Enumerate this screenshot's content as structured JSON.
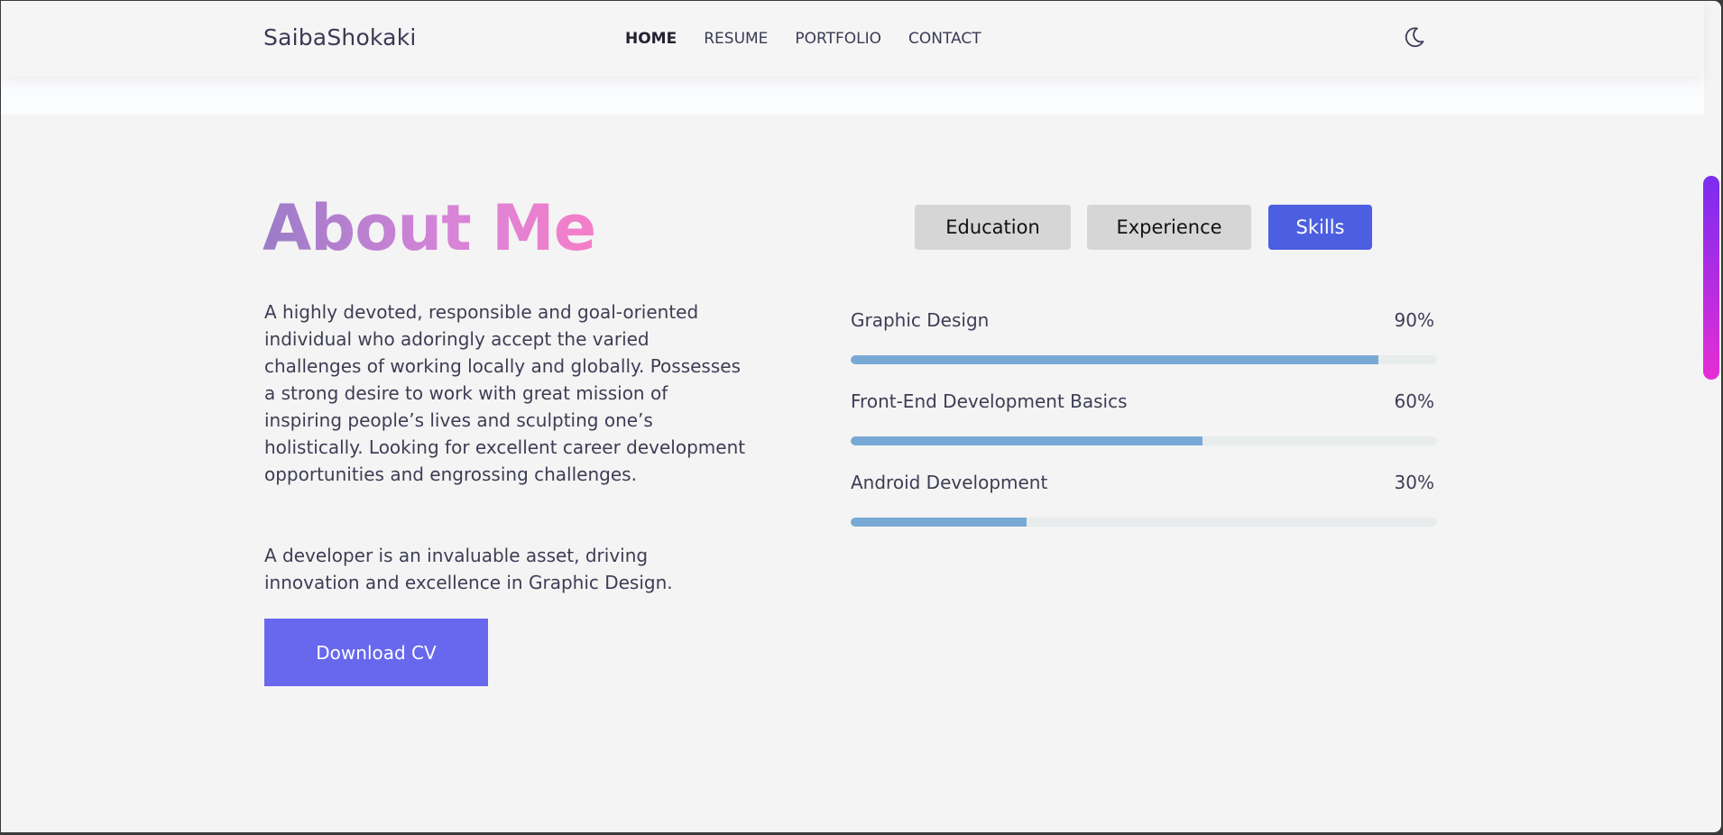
{
  "header": {
    "brand": "SaibaShokaki",
    "nav": [
      {
        "label": "HOME",
        "active": true
      },
      {
        "label": "RESUME",
        "active": false
      },
      {
        "label": "PORTFOLIO",
        "active": false
      },
      {
        "label": "CONTACT",
        "active": false
      }
    ],
    "theme_icon": "moon-icon"
  },
  "about": {
    "title": "About Me",
    "bio": "A highly devoted, responsible and goal-oriented individual who adoringly accept the varied challenges of working locally and globally. Possesses a strong desire to work with great mission of inspiring people’s lives and sculpting one’s holistically. Looking for excellent career development opportunities and engrossing challenges.",
    "bio2": "A developer is an invaluable asset, driving innovation and excellence in Graphic Design.",
    "download_label": "Download CV"
  },
  "tabs": [
    {
      "label": "Education",
      "active": false
    },
    {
      "label": "Experience",
      "active": false
    },
    {
      "label": "Skills",
      "active": true
    }
  ],
  "skills": [
    {
      "name": "Graphic Design",
      "percent_label": "90%",
      "level": 0.9
    },
    {
      "name": "Front-End Development Basics",
      "percent_label": "60%",
      "level": 0.6
    },
    {
      "name": "Android Development",
      "percent_label": "30%",
      "level": 0.3
    }
  ],
  "colors": {
    "accent": "#6768ee",
    "active_tab": "#4c5fe0",
    "progress_fill": "#78a9d4",
    "progress_track": "#e8ecec",
    "title_gradient_start": "#9b7cc8",
    "title_gradient_end": "#f57ec8",
    "scrollbar_start": "#7b2cf0",
    "scrollbar_end": "#e62ed4"
  }
}
